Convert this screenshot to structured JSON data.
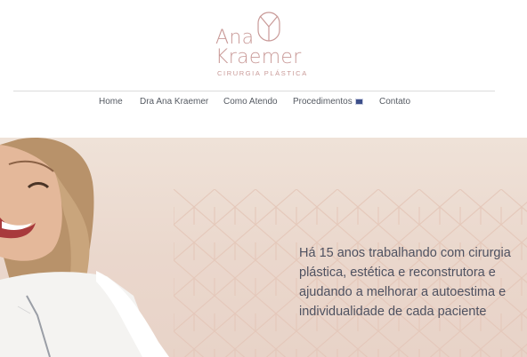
{
  "logo": {
    "name_line1": "Ana",
    "name_line2": "Kraemer",
    "subtitle": "CIRURGIA PLÁSTICA"
  },
  "nav": {
    "items": [
      {
        "label": "Home"
      },
      {
        "label": "Dra Ana Kraemer"
      },
      {
        "label": "Como Atendo"
      },
      {
        "label": "Procedimentos"
      },
      {
        "label": "Contato"
      }
    ],
    "dropdown_icon": "flag-icon"
  },
  "hero": {
    "lines": [
      "Há 15 anos trabalhando com cirurgia",
      "plástica, estética e reconstrutora e",
      "ajudando a melhorar a autoestima e",
      "individualidade de cada paciente"
    ]
  },
  "colors": {
    "brand": "#c99a98",
    "nav_text": "#555a62",
    "hero_text": "#4e5160",
    "hero_bg": "#ecdcd1",
    "flag": "#3d4f8a"
  }
}
